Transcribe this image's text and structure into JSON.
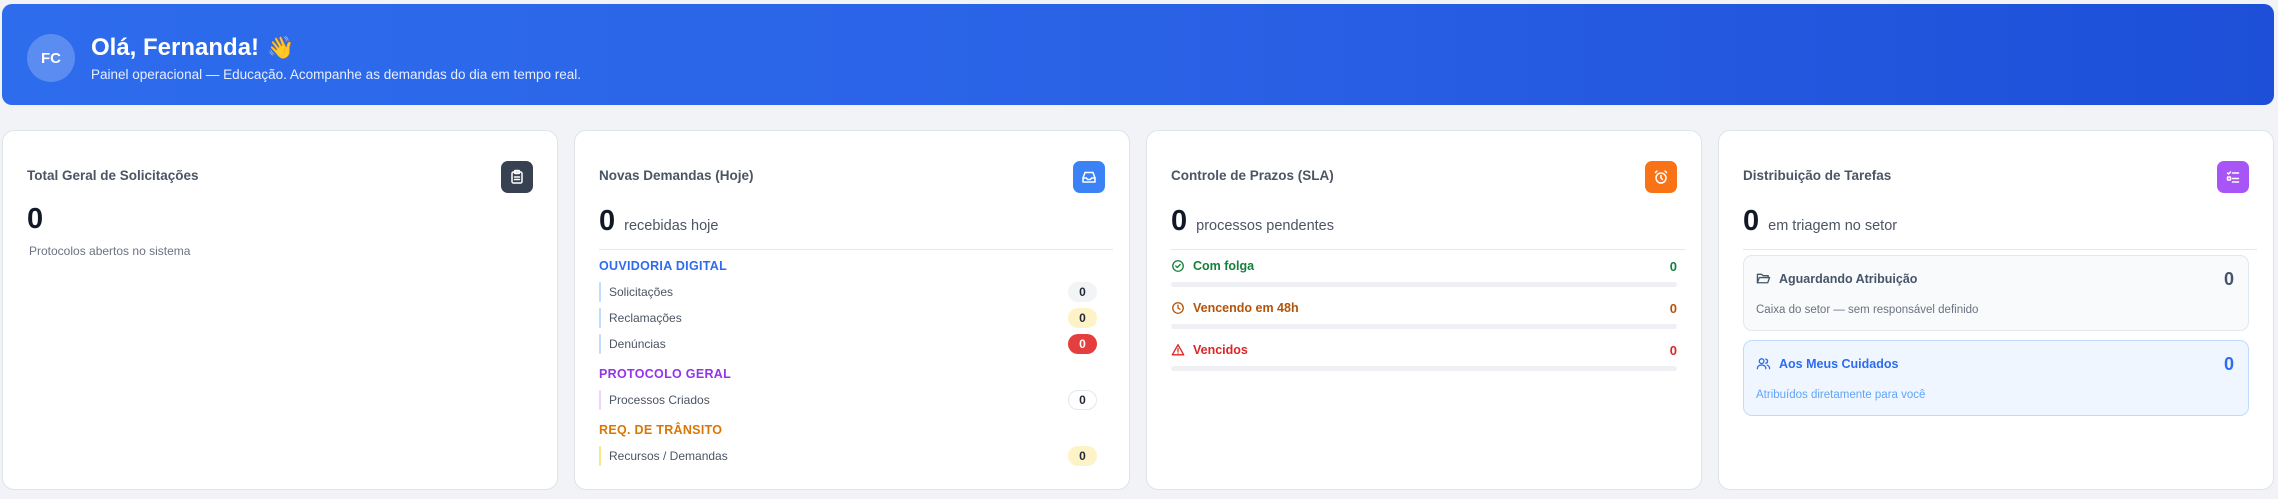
{
  "header": {
    "initials": "FC",
    "greeting": "Olá, Fernanda!",
    "wave_emoji": "👋",
    "subtitle": "Painel operacional — Educação. Acompanhe as demandas do dia em tempo real."
  },
  "cards": {
    "total": {
      "title": "Total Geral de Solicitações",
      "icon": "clipboard-icon",
      "value": "0",
      "caption": "Protocolos abertos no sistema"
    },
    "novas": {
      "title": "Novas Demandas (Hoje)",
      "icon": "inbox-icon",
      "value": "0",
      "suffix": "recebidas hoje",
      "groups": [
        {
          "label": "OUVIDORIA DIGITAL",
          "color": "#2d6ced",
          "items": [
            {
              "label": "Solicitações",
              "count": "0",
              "variant": "neutral"
            },
            {
              "label": "Reclamações",
              "count": "0",
              "variant": "yellow"
            },
            {
              "label": "Denúncias",
              "count": "0",
              "variant": "red"
            }
          ]
        },
        {
          "label": "PROTOCOLO GERAL",
          "color": "#9333ea",
          "items": [
            {
              "label": "Processos Criados",
              "count": "0",
              "variant": "white"
            }
          ]
        },
        {
          "label": "REQ. DE TRÂNSITO",
          "color": "#d97706",
          "items": [
            {
              "label": "Recursos / Demandas",
              "count": "0",
              "variant": "yellow"
            }
          ]
        }
      ]
    },
    "prazos": {
      "title": "Controle de Prazos (SLA)",
      "icon": "alarm-clock-icon",
      "value": "0",
      "suffix": "processos pendentes",
      "rows": [
        {
          "label": "Com folga",
          "count": "0",
          "color": "#15803d",
          "icon": "check-circle-icon",
          "fill_fraction": 0
        },
        {
          "label": "Vencendo em 48h",
          "count": "0",
          "color": "#b45309",
          "icon": "clock-icon",
          "fill_fraction": 0
        },
        {
          "label": "Vencidos",
          "count": "0",
          "color": "#dc2626",
          "icon": "warning-triangle-icon",
          "fill_fraction": 0
        }
      ]
    },
    "distribuicao": {
      "title": "Distribuição de Tarefas",
      "icon": "task-list-icon",
      "value": "0",
      "suffix": "em triagem no setor",
      "aguardando": {
        "title": "Aguardando Atribuição",
        "count": "0",
        "desc": "Caixa do setor — sem responsável definido",
        "icon": "folder-open-icon"
      },
      "meus": {
        "title": "Aos Meus Cuidados",
        "count": "0",
        "desc": "Atribuídos diretamente para você",
        "icon": "users-icon"
      }
    }
  },
  "colors": {
    "header_gradient_start": "#2d6ced",
    "header_gradient_end": "#1d4fd8",
    "icon_dark": "#374151",
    "icon_blue": "#3b82f6",
    "icon_orange": "#f97316",
    "icon_purple": "#a855f7"
  }
}
